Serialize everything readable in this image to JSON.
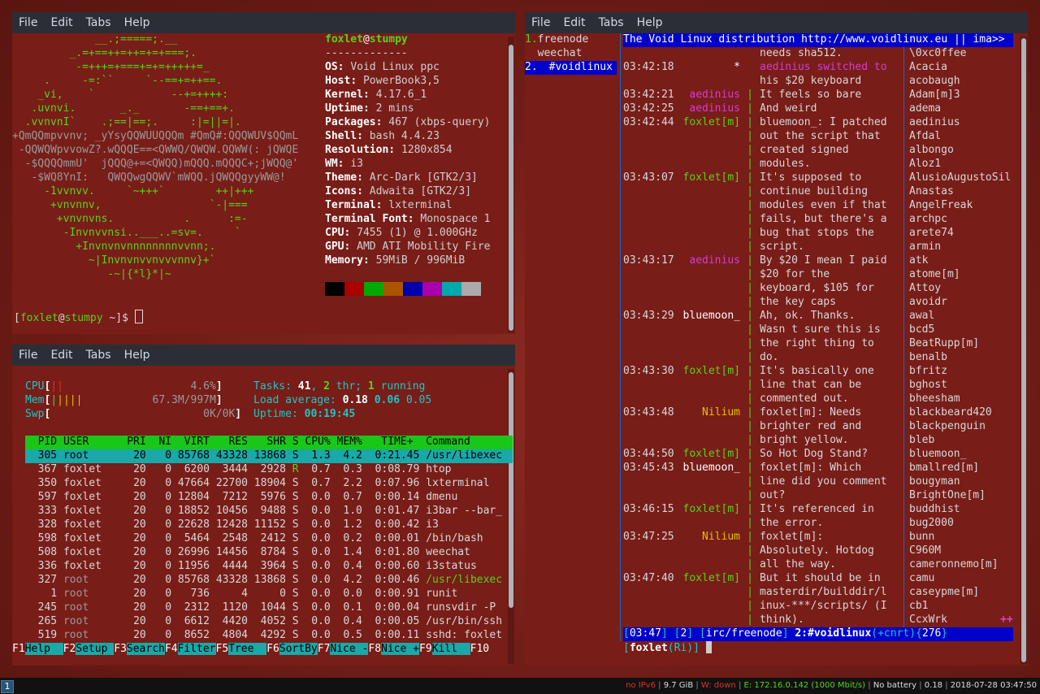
{
  "menus": [
    "File",
    "Edit",
    "Tabs",
    "Help"
  ],
  "neofetch": {
    "logo": [
      "             __.;=====;.__",
      "         _.=+==++=++=+=+===;.",
      "          -=+++=+===+=+=+++++=_",
      "     .     -=:``     `--==+=++==.",
      "    _vi,    `            --+=++++:",
      "   .uvnvi.       _._       -==+==+.",
      "  .vvnvnI`    .;==|==;.     :|=||=|.",
      "+QmQQmpvvnv; _yYsyQQWUUQQQm #QmQ#:QQQWUV$QQmL",
      " -QQWQWpvvowZ?.wQQQE==<QWWQ/QWQW.QQWW(: jQWQE",
      "  -$QQQQmmU'  jQQQ@+=<QWQQ)mQQQ.mQQQC+;jWQQ@'",
      "   -$WQ8YnI:   QWQQwgQQWV`mWQQ.jQWQQgyyWW@!",
      "     -1vvnvv.     `~+++`        ++|+++",
      "      +vnvnnv,                 `-|===",
      "       +vnvnvns.           .      :=-",
      "        -Invnvvnsi..___..=sv=.     `",
      "          +Invnvnvnnnnnnnnvvnn;.",
      "            ~|Invnvnvvnvvvnnv}+`",
      "               -~|{*l}*|~"
    ],
    "user": "foxlet",
    "at": "@",
    "host": "stumpy",
    "separator": "-------------",
    "info": [
      {
        "k": "OS",
        "v": "Void Linux ppc"
      },
      {
        "k": "Host",
        "v": "PowerBook3,5"
      },
      {
        "k": "Kernel",
        "v": "4.17.6_1"
      },
      {
        "k": "Uptime",
        "v": "2 mins"
      },
      {
        "k": "Packages",
        "v": "467 (xbps-query)"
      },
      {
        "k": "Shell",
        "v": "bash 4.4.23"
      },
      {
        "k": "Resolution",
        "v": "1280x854"
      },
      {
        "k": "WM",
        "v": "i3"
      },
      {
        "k": "Theme",
        "v": "Arc-Dark [GTK2/3]"
      },
      {
        "k": "Icons",
        "v": "Adwaita [GTK2/3]"
      },
      {
        "k": "Terminal",
        "v": "lxterminal"
      },
      {
        "k": "Terminal Font",
        "v": "Monospace 1"
      },
      {
        "k": "CPU",
        "v": "7455 (1) @ 1.000GHz"
      },
      {
        "k": "GPU",
        "v": "AMD ATI Mobility Fire"
      },
      {
        "k": "Memory",
        "v": "59MiB / 996MiB"
      }
    ],
    "swatches": [
      "#000000",
      "#aa0000",
      "#00aa00",
      "#aa5500",
      "#0000aa",
      "#aa00aa",
      "#00aaaa",
      "#aaaaaa"
    ],
    "prompt_user": "foxlet",
    "prompt_host": "stumpy",
    "prompt_dir": "~",
    "prompt_suffix": "]$ "
  },
  "htop": {
    "cpu_label": "CPU",
    "cpu_pct": "4.6%",
    "mem_label": "Mem",
    "mem_val": "67.3M/997M",
    "swp_label": "Swp",
    "swp_val": "0K/0K",
    "tasks_label": "Tasks:",
    "tasks": "41",
    "thr": "2",
    "thr_label": "thr;",
    "running": "1",
    "running_label": "running",
    "load_label": "Load average:",
    "load1": "0.18",
    "load5": "0.06",
    "load15": "0.05",
    "uptime_label": "Uptime:",
    "uptime": "00:19:45",
    "header": "  PID USER      PRI  NI  VIRT   RES   SHR S CPU% MEM%   TIME+  Command",
    "rows": [
      {
        "pid": "305",
        "user": "root",
        "pri": "20",
        "ni": "0",
        "virt": "85768",
        "res": "43328",
        "shr": "13868",
        "s": "S",
        "cpu": "1.3",
        "mem": "4.2",
        "time": "0:21.45",
        "cmd": "/usr/libexec"
      },
      {
        "pid": "367",
        "user": "foxlet",
        "pri": "20",
        "ni": "0",
        "virt": "6200",
        "res": "3444",
        "shr": "2928",
        "s": "R",
        "cpu": "0.7",
        "mem": "0.3",
        "time": "0:08.79",
        "cmd": "htop"
      },
      {
        "pid": "350",
        "user": "foxlet",
        "pri": "20",
        "ni": "0",
        "virt": "47664",
        "res": "22700",
        "shr": "18904",
        "s": "S",
        "cpu": "0.7",
        "mem": "2.2",
        "time": "0:07.96",
        "cmd": "lxterminal"
      },
      {
        "pid": "597",
        "user": "foxlet",
        "pri": "20",
        "ni": "0",
        "virt": "12804",
        "res": "7212",
        "shr": "5976",
        "s": "S",
        "cpu": "0.0",
        "mem": "0.7",
        "time": "0:00.14",
        "cmd": "dmenu"
      },
      {
        "pid": "333",
        "user": "foxlet",
        "pri": "20",
        "ni": "0",
        "virt": "18852",
        "res": "10456",
        "shr": "9488",
        "s": "S",
        "cpu": "0.0",
        "mem": "1.0",
        "time": "0:01.47",
        "cmd": "i3bar --bar_"
      },
      {
        "pid": "328",
        "user": "foxlet",
        "pri": "20",
        "ni": "0",
        "virt": "22628",
        "res": "12428",
        "shr": "11152",
        "s": "S",
        "cpu": "0.0",
        "mem": "1.2",
        "time": "0:00.42",
        "cmd": "i3"
      },
      {
        "pid": "598",
        "user": "foxlet",
        "pri": "20",
        "ni": "0",
        "virt": "5464",
        "res": "2548",
        "shr": "2412",
        "s": "S",
        "cpu": "0.0",
        "mem": "0.2",
        "time": "0:00.01",
        "cmd": "/bin/bash"
      },
      {
        "pid": "508",
        "user": "foxlet",
        "pri": "20",
        "ni": "0",
        "virt": "26996",
        "res": "14456",
        "shr": "8784",
        "s": "S",
        "cpu": "0.0",
        "mem": "1.4",
        "time": "0:01.80",
        "cmd": "weechat"
      },
      {
        "pid": "336",
        "user": "foxlet",
        "pri": "20",
        "ni": "0",
        "virt": "11956",
        "res": "4444",
        "shr": "3964",
        "s": "S",
        "cpu": "0.0",
        "mem": "0.4",
        "time": "0:00.60",
        "cmd": "i3status"
      },
      {
        "pid": "327",
        "user": "root",
        "pri": "20",
        "ni": "0",
        "virt": "85768",
        "res": "43328",
        "shr": "13868",
        "s": "S",
        "cpu": "0.0",
        "mem": "4.2",
        "time": "0:00.46",
        "cmd": "/usr/libexec"
      },
      {
        "pid": "1",
        "user": "root",
        "pri": "20",
        "ni": "0",
        "virt": "736",
        "res": "4",
        "shr": "0",
        "s": "S",
        "cpu": "0.0",
        "mem": "0.0",
        "time": "0:00.91",
        "cmd": "runit"
      },
      {
        "pid": "245",
        "user": "root",
        "pri": "20",
        "ni": "0",
        "virt": "2312",
        "res": "1120",
        "shr": "1044",
        "s": "S",
        "cpu": "0.0",
        "mem": "0.1",
        "time": "0:00.04",
        "cmd": "runsvdir -P"
      },
      {
        "pid": "265",
        "user": "root",
        "pri": "20",
        "ni": "0",
        "virt": "6612",
        "res": "4420",
        "shr": "4052",
        "s": "S",
        "cpu": "0.0",
        "mem": "0.4",
        "time": "0:00.05",
        "cmd": "/usr/bin/ssh"
      },
      {
        "pid": "519",
        "user": "root",
        "pri": "20",
        "ni": "0",
        "virt": "8652",
        "res": "4804",
        "shr": "4292",
        "s": "S",
        "cpu": "0.0",
        "mem": "0.5",
        "time": "0:00.11",
        "cmd": "sshd: foxlet"
      }
    ],
    "fkeys": [
      {
        "k": "F1",
        "l": "Help  "
      },
      {
        "k": "F2",
        "l": "Setup "
      },
      {
        "k": "F3",
        "l": "Search"
      },
      {
        "k": "F4",
        "l": "Filter"
      },
      {
        "k": "F5",
        "l": "Tree  "
      },
      {
        "k": "F6",
        "l": "SortBy"
      },
      {
        "k": "F7",
        "l": "Nice -"
      },
      {
        "k": "F8",
        "l": "Nice +"
      },
      {
        "k": "F9",
        "l": "Kill  "
      },
      {
        "k": "F10",
        "l": ""
      }
    ]
  },
  "weechat": {
    "buffers": [
      {
        "n": "1.",
        "name": "freenode"
      },
      {
        "n": "",
        "name": "weechat"
      },
      {
        "n": "2.",
        "name": "#voidlinux"
      }
    ],
    "topic": "The Void Linux distribution http://www.voidlinux.eu || ima>>",
    "messages": [
      {
        "t": "",
        "nick": "",
        "sep": "",
        "text": "needs sha512."
      },
      {
        "t": "03:42:18",
        "nick": "*",
        "sep": "",
        "text": "aedinius switched to"
      },
      {
        "t": "",
        "nick": "",
        "sep": "",
        "text": "his $20 keyboard"
      },
      {
        "t": "03:42:21",
        "nick": "aedinius",
        "sep": "|",
        "text": "It feels so bare"
      },
      {
        "t": "03:42:25",
        "nick": "aedinius",
        "sep": "|",
        "text": "And weird"
      },
      {
        "t": "03:42:44",
        "nick": "foxlet[m]",
        "sep": "|",
        "text": "bluemoon_: I patched"
      },
      {
        "t": "",
        "nick": "",
        "sep": "|",
        "text": "out the script that"
      },
      {
        "t": "",
        "nick": "",
        "sep": "|",
        "text": "created signed"
      },
      {
        "t": "",
        "nick": "",
        "sep": "|",
        "text": "modules."
      },
      {
        "t": "03:43:07",
        "nick": "foxlet[m]",
        "sep": "|",
        "text": "It's supposed to"
      },
      {
        "t": "",
        "nick": "",
        "sep": "|",
        "text": "continue building"
      },
      {
        "t": "",
        "nick": "",
        "sep": "|",
        "text": "modules even if that"
      },
      {
        "t": "",
        "nick": "",
        "sep": "|",
        "text": "fails, but there's a"
      },
      {
        "t": "",
        "nick": "",
        "sep": "|",
        "text": "bug that stops the"
      },
      {
        "t": "",
        "nick": "",
        "sep": "|",
        "text": "script."
      },
      {
        "t": "03:43:17",
        "nick": "aedinius",
        "sep": "|",
        "text": "By $20 I mean I paid"
      },
      {
        "t": "",
        "nick": "",
        "sep": "|",
        "text": "$20 for the"
      },
      {
        "t": "",
        "nick": "",
        "sep": "|",
        "text": "keyboard, $105 for"
      },
      {
        "t": "",
        "nick": "",
        "sep": "|",
        "text": "the key caps"
      },
      {
        "t": "03:43:29",
        "nick": "bluemoon_",
        "sep": "|",
        "text": "Ah, ok. Thanks."
      },
      {
        "t": "",
        "nick": "",
        "sep": "|",
        "text": "Wasn t sure this is"
      },
      {
        "t": "",
        "nick": "",
        "sep": "|",
        "text": "the right thing to"
      },
      {
        "t": "",
        "nick": "",
        "sep": "|",
        "text": "do."
      },
      {
        "t": "03:43:30",
        "nick": "foxlet[m]",
        "sep": "|",
        "text": "It's basically one"
      },
      {
        "t": "",
        "nick": "",
        "sep": "|",
        "text": "line that can be"
      },
      {
        "t": "",
        "nick": "",
        "sep": "|",
        "text": "commented out."
      },
      {
        "t": "03:43:48",
        "nick": "Nilium",
        "sep": "|",
        "text": "foxlet[m]: Needs"
      },
      {
        "t": "",
        "nick": "",
        "sep": "|",
        "text": "brighter red and"
      },
      {
        "t": "",
        "nick": "",
        "sep": "|",
        "text": "bright yellow."
      },
      {
        "t": "03:44:50",
        "nick": "foxlet[m]",
        "sep": "|",
        "text": "So Hot Dog Stand?"
      },
      {
        "t": "03:45:43",
        "nick": "bluemoon_",
        "sep": "|",
        "text": "foxlet[m]: Which"
      },
      {
        "t": "",
        "nick": "",
        "sep": "|",
        "text": "line did you comment"
      },
      {
        "t": "",
        "nick": "",
        "sep": "|",
        "text": "out?"
      },
      {
        "t": "03:46:15",
        "nick": "foxlet[m]",
        "sep": "|",
        "text": "It's referenced in"
      },
      {
        "t": "",
        "nick": "",
        "sep": "|",
        "text": "the error."
      },
      {
        "t": "03:47:25",
        "nick": "Nilium",
        "sep": "|",
        "text": "foxlet[m]:"
      },
      {
        "t": "",
        "nick": "",
        "sep": "|",
        "text": "Absolutely. Hotdog"
      },
      {
        "t": "",
        "nick": "",
        "sep": "|",
        "text": "all the way."
      },
      {
        "t": "03:47:40",
        "nick": "foxlet[m]",
        "sep": "|",
        "text": "But it should be in"
      },
      {
        "t": "",
        "nick": "",
        "sep": "|",
        "text": "masterdir/builddir/l"
      },
      {
        "t": "",
        "nick": "",
        "sep": "|",
        "text": "inux-***/scripts/ (I"
      },
      {
        "t": "",
        "nick": "",
        "sep": "|",
        "text": "think)."
      }
    ],
    "nicklist": [
      "\\0xc0ffee",
      "Acacia",
      "acobaugh",
      "Adam[m]3",
      "adema",
      "aedinius",
      "Afdal",
      "albongo",
      "Aloz1",
      "AlusioAugustoSil",
      "Anastas",
      "AngelFreak",
      "archpc",
      "arete74",
      "armin",
      "atk",
      "atome[m]",
      "Attoy",
      "avoidr",
      "awal",
      "bcd5",
      "BeatRupp[m]",
      "benalb",
      "bfritz",
      "bghost",
      "bheesham",
      "blackbeard420",
      "blackpenguin",
      "bleb",
      "bluemoon_",
      "bmallred[m]",
      "bougyman",
      "BrightOne[m]",
      "buddhist",
      "bug2000",
      "bunn",
      "C960M",
      "cameronnemo[m]",
      "camu",
      "caseypme[m]",
      "cb1",
      "CcxWrk"
    ],
    "more_marker": "++",
    "status": "[03:47] [2] [irc/freenode] 2:#voidlinux(+cnrt){276}",
    "input_nick": "foxlet",
    "input_mode": "(Ri)"
  },
  "i3bar": {
    "workspace": "1",
    "items": [
      {
        "text": "no IPv6",
        "color": "#e23030"
      },
      {
        "text": "9.7 GiB",
        "color": "#dddddd"
      },
      {
        "text": "W: down",
        "color": "#e23030"
      },
      {
        "text": "E: 172.16.0.142 (1000 Mbit/s)",
        "color": "#59d316"
      },
      {
        "text": "No battery",
        "color": "#dddddd"
      },
      {
        "text": "0.18",
        "color": "#dddddd"
      },
      {
        "text": "2018-07-28 03:47:50",
        "color": "#dddddd"
      }
    ]
  }
}
